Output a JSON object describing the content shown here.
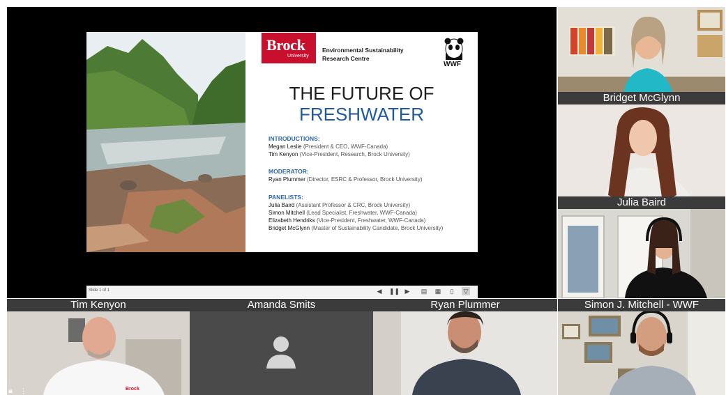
{
  "slide": {
    "logo_brock": "Brock",
    "logo_university": "University",
    "esrc_line1": "Environmental Sustainability",
    "esrc_line2": "Research Centre",
    "wwf": "WWF",
    "title_line1": "THE FUTURE OF",
    "title_line2": "FRESHWATER",
    "introductions_heading": "INTRODUCTIONS:",
    "introductions": [
      {
        "name": "Megan Leslie",
        "role": "(President & CEO, WWF-Canada)"
      },
      {
        "name": "Tim Kenyon",
        "role": "(Vice-President, Research, Brock University)"
      }
    ],
    "moderator_heading": "MODERATOR:",
    "moderator": [
      {
        "name": "Ryan Plummer",
        "role": "(Director, ESRC & Professor, Brock University)"
      }
    ],
    "panelists_heading": "PANELISTS:",
    "panelists": [
      {
        "name": "Julia Baird",
        "role": "(Assistant Professor & CRC, Brock University)"
      },
      {
        "name": "Simon Mitchell",
        "role": "(Lead Specialist, Freshwater, WWF-Canada)"
      },
      {
        "name": "Elizabeth Hendriks",
        "role": "(Vice-President, Freshwater, WWF-Canada)"
      },
      {
        "name": "Bridget McGlynn",
        "role": "(Master of Sustainability Candidate, Brock University)"
      }
    ]
  },
  "status": {
    "slide_count": "Slide 1 of 1",
    "controls": [
      "prev-icon",
      "pause-icon",
      "next-icon",
      "normal-view-icon",
      "slide-sorter-icon",
      "reading-view-icon",
      "slideshow-icon"
    ]
  },
  "participants": {
    "bridget": "Bridget McGlynn",
    "julia": "Julia Baird",
    "simon": "Simon J. Mitchell - WWF",
    "tim": "Tim Kenyon",
    "amanda": "Amanda Smits",
    "ryan": "Ryan Plummer"
  },
  "shirt_logo": "Brock"
}
